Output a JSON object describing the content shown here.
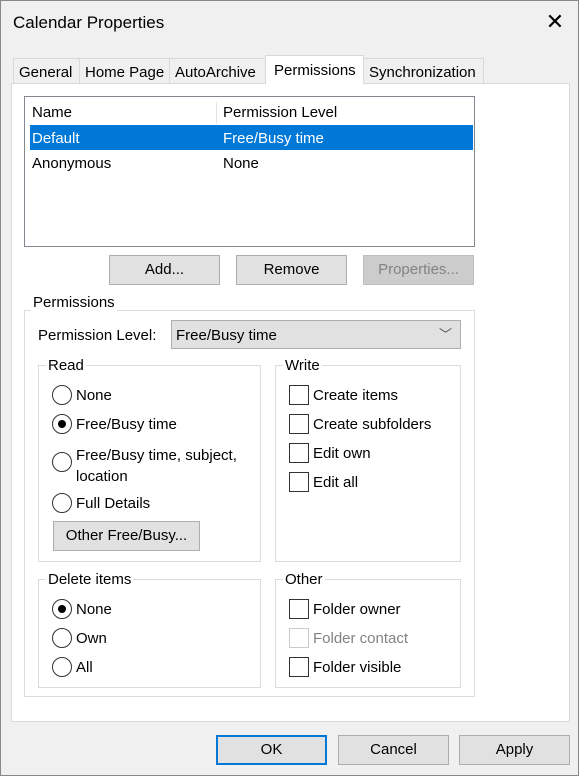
{
  "window": {
    "title": "Calendar Properties",
    "close_icon": "close-icon"
  },
  "tabs": [
    {
      "label": "General"
    },
    {
      "label": "Home Page"
    },
    {
      "label": "AutoArchive"
    },
    {
      "label": "Permissions",
      "selected": true
    },
    {
      "label": "Synchronization"
    }
  ],
  "list": {
    "columns": [
      "Name",
      "Permission Level"
    ],
    "rows": [
      {
        "name": "Default",
        "level": "Free/Busy time",
        "selected": true
      },
      {
        "name": "Anonymous",
        "level": "None"
      }
    ],
    "selection_color": "#0078d7"
  },
  "list_buttons": {
    "add": "Add...",
    "remove": "Remove",
    "properties": "Properties..."
  },
  "permissions": {
    "group_label": "Permissions",
    "level_label": "Permission Level:",
    "level_value": "Free/Busy time",
    "read": {
      "label": "Read",
      "options": [
        "None",
        "Free/Busy time",
        "Free/Busy time, subject, location",
        "Full Details"
      ],
      "selected": "Free/Busy time",
      "other_button": "Other Free/Busy..."
    },
    "write": {
      "label": "Write",
      "options": [
        {
          "label": "Create items",
          "checked": false
        },
        {
          "label": "Create subfolders",
          "checked": false
        },
        {
          "label": "Edit own",
          "checked": false
        },
        {
          "label": "Edit all",
          "checked": false
        }
      ]
    },
    "delete": {
      "label": "Delete items",
      "options": [
        "None",
        "Own",
        "All"
      ],
      "selected": "None"
    },
    "other": {
      "label": "Other",
      "options": [
        {
          "label": "Folder owner",
          "checked": false
        },
        {
          "label": "Folder contact",
          "checked": false,
          "disabled": true
        },
        {
          "label": "Folder visible",
          "checked": false
        }
      ]
    }
  },
  "footer": {
    "ok": "OK",
    "cancel": "Cancel",
    "apply": "Apply"
  }
}
